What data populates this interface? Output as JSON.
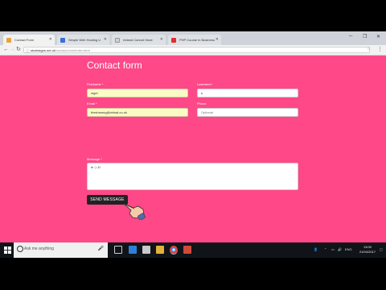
{
  "tabs": [
    {
      "title": "Contact Form",
      "active": true,
      "icon_color": "#e8a33a"
    },
    {
      "title": "Simple Web Hosting U",
      "active": false,
      "icon_color": "#3a6ed8"
    },
    {
      "title": "Ireland Cannot Have",
      "active": false,
      "icon_color": "#cfcfcf"
    },
    {
      "title": "PHP Course in Business",
      "active": false,
      "icon_color": "#e52d27"
    }
  ],
  "address": {
    "host": "stcdesigns.me.uk",
    "path": "/contact-form/index.html"
  },
  "form": {
    "title": "Contact form",
    "firstname_label": "Firstname",
    "firstname_value": "nigel",
    "lastname_label": "Lastname",
    "lastname_value": "s",
    "email_label": "Email",
    "email_value": "theshmsng@virtual.co.uk",
    "phone_label": "Phone",
    "phone_placeholder": "Optional",
    "message_label": "Message",
    "message_value": "hi :) :D",
    "send_label": "SEND MESSAGE",
    "required_mark": "*"
  },
  "taskbar": {
    "search_placeholder": "Ask me anything",
    "language": "ENG",
    "time": "13:00",
    "date": "21/04/2017"
  }
}
